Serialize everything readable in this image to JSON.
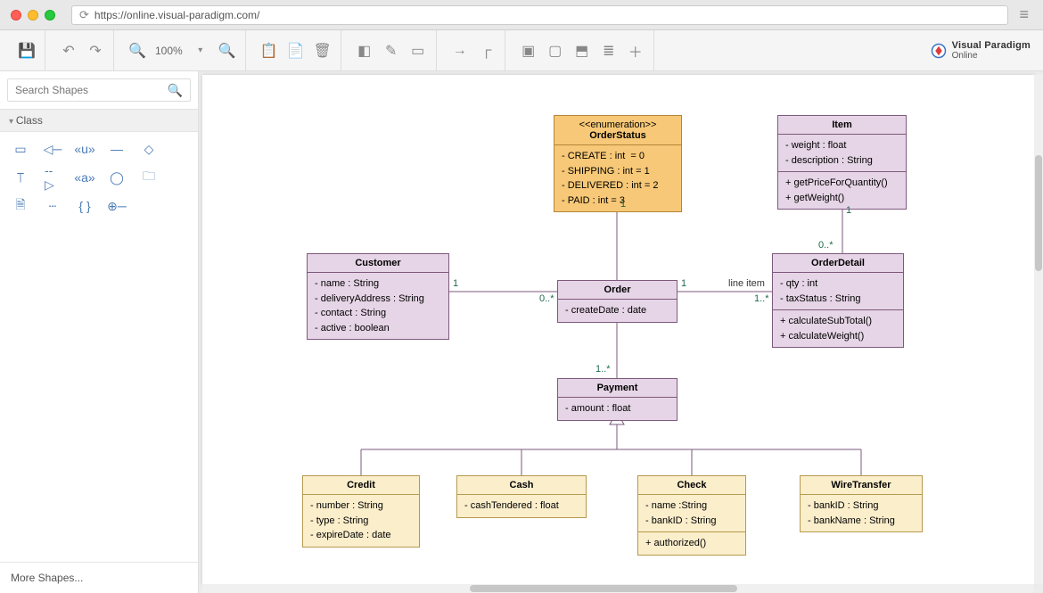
{
  "url": "https://online.visual-paradigm.com/",
  "zoom": "100%",
  "brand": {
    "line1": "Visual Paradigm",
    "line2": "Online"
  },
  "search_placeholder": "Search Shapes",
  "sidebar": {
    "section_title": "Class",
    "more_shapes": "More Shapes..."
  },
  "chart_data": {
    "type": "uml_class_diagram",
    "classes": {
      "OrderStatus": {
        "stereotype": "<<enumeration>>",
        "name": "OrderStatus",
        "color": "orange",
        "attributes": "- CREATE : int  = 0\n- SHIPPING : int = 1\n- DELIVERED : int = 2\n- PAID : int = 3"
      },
      "Item": {
        "name": "Item",
        "color": "purple",
        "attributes": "- weight : float\n- description : String",
        "operations": "+ getPriceForQuantity()\n+ getWeight()"
      },
      "Customer": {
        "name": "Customer",
        "color": "purple",
        "attributes": "- name : String\n- deliveryAddress : String\n- contact : String\n- active : boolean"
      },
      "Order": {
        "name": "Order",
        "color": "purple",
        "attributes": "- createDate : date"
      },
      "OrderDetail": {
        "name": "OrderDetail",
        "color": "purple",
        "attributes": "- qty : int\n- taxStatus : String",
        "operations": "+ calculateSubTotal()\n+ calculateWeight()"
      },
      "Payment": {
        "name": "Payment",
        "color": "purple",
        "attributes": "- amount : float"
      },
      "Credit": {
        "name": "Credit",
        "color": "cream",
        "attributes": "- number : String\n- type : String\n- expireDate : date"
      },
      "Cash": {
        "name": "Cash",
        "color": "cream",
        "attributes": "- cashTendered : float"
      },
      "Check": {
        "name": "Check",
        "color": "cream",
        "attributes": "- name :String\n- bankID : String",
        "operations": "+ authorized()"
      },
      "WireTransfer": {
        "name": "WireTransfer",
        "color": "cream",
        "attributes": "- bankID : String\n- bankName : String"
      }
    },
    "associations": [
      {
        "from": "Customer",
        "to": "Order",
        "from_mult": "1",
        "to_mult": "0..*"
      },
      {
        "from": "Order",
        "to": "OrderStatus",
        "to_mult": "1"
      },
      {
        "from": "Order",
        "to": "OrderDetail",
        "label": "line item",
        "from_mult": "1",
        "to_mult": "1..*"
      },
      {
        "from": "Order",
        "to": "Payment",
        "to_mult": "1..*"
      },
      {
        "from": "OrderDetail",
        "to": "Item",
        "from_mult": "0..*",
        "to_mult": "1"
      }
    ],
    "generalizations": [
      {
        "parent": "Payment",
        "children": [
          "Credit",
          "Cash",
          "Check",
          "WireTransfer"
        ]
      }
    ]
  },
  "labels": {
    "m1": "1",
    "m0s": "0..*",
    "m1s": "1..*",
    "lineitem": "line item"
  }
}
